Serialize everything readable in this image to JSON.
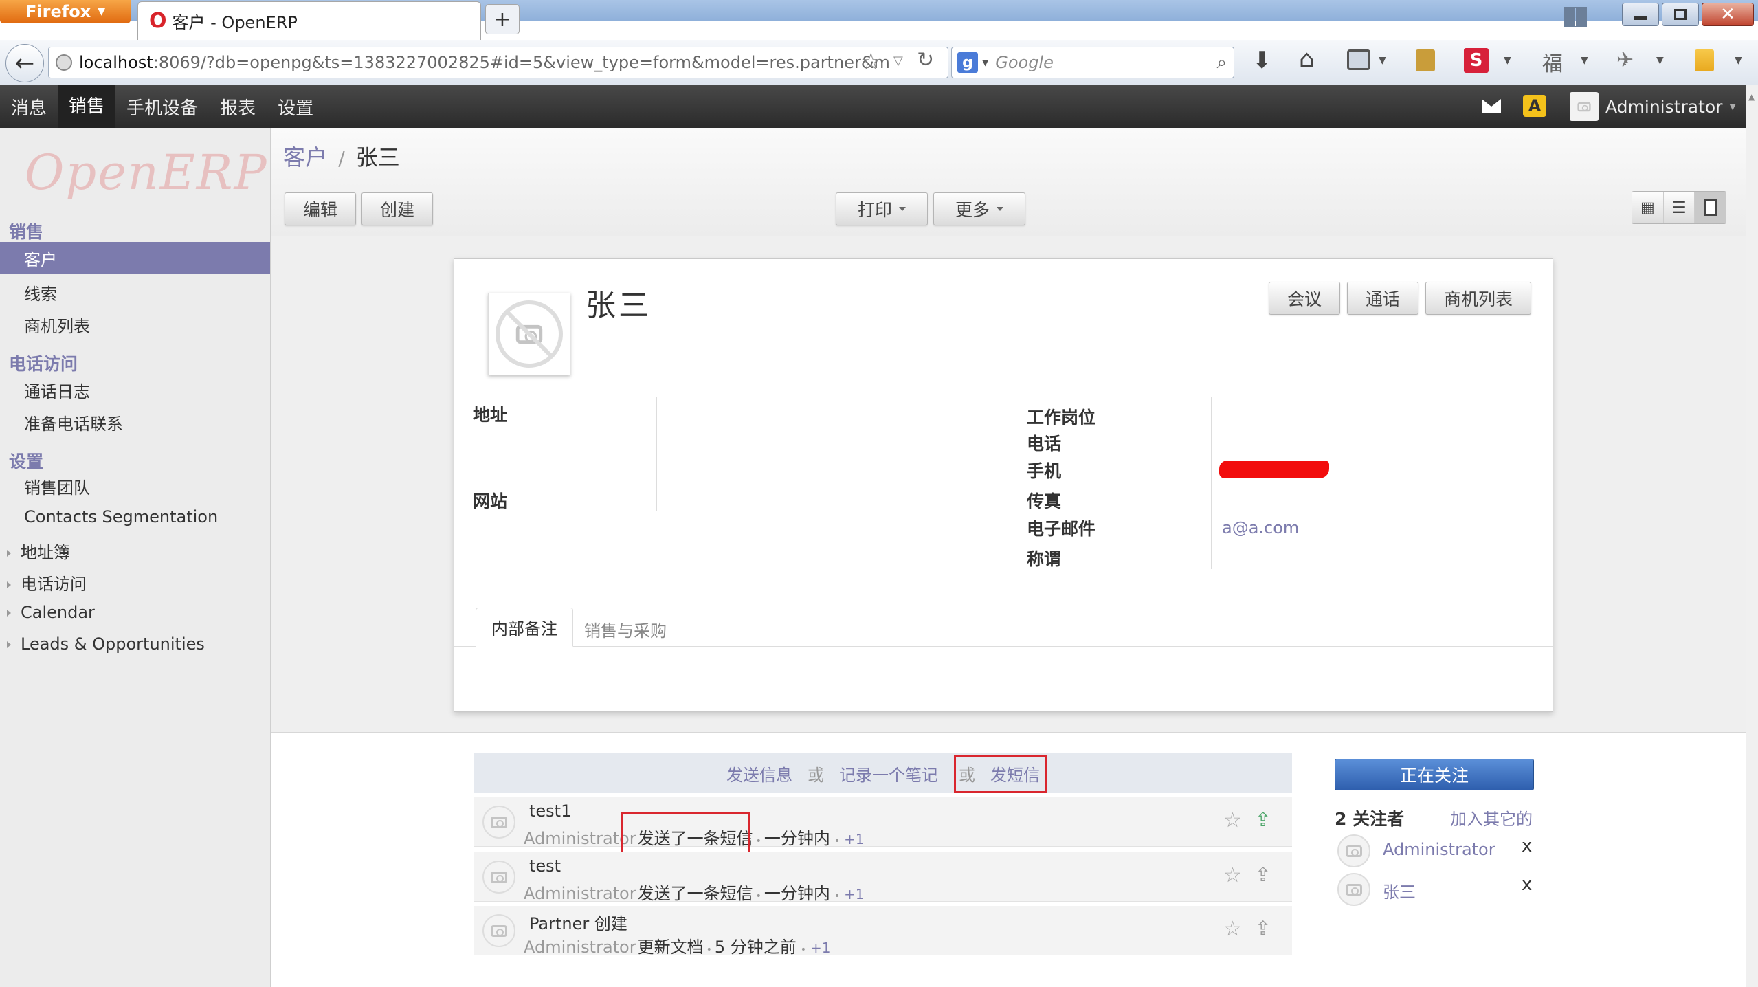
{
  "browser": {
    "app_button": "Firefox",
    "tab_title": "客户 - OpenERP",
    "new_tab": "+",
    "url_host": "localhost",
    "url_rest": ":8069/?db=openpg&ts=1383227002825#id=5&view_type=form&model=res.partner&m",
    "search_placeholder": "Google"
  },
  "topnav": {
    "items": [
      "消息",
      "销售",
      "手机设备",
      "报表",
      "设置"
    ],
    "user": "Administrator"
  },
  "sidebar": {
    "logo": "OpenERP",
    "sections": [
      {
        "title": "销售",
        "items": [
          "客户",
          "线索",
          "商机列表"
        ]
      },
      {
        "title": "电话访问",
        "items": [
          "通话日志",
          "准备电话联系"
        ]
      },
      {
        "title": "设置",
        "items": [
          "销售团队",
          "Contacts Segmentation"
        ]
      }
    ],
    "expandable": [
      "地址簿",
      "电话访问",
      "Calendar",
      "Leads & Opportunities"
    ]
  },
  "breadcrumb": {
    "parent": "客户",
    "sep": "/",
    "current": "张三"
  },
  "toolbar": {
    "edit": "编辑",
    "create": "创建",
    "print": "打印",
    "more": "更多"
  },
  "form": {
    "name": "张三",
    "buttons": [
      "会议",
      "通话",
      "商机列表"
    ],
    "left_labels": {
      "address": "地址",
      "website": "网站"
    },
    "right_labels": [
      "工作岗位",
      "电话",
      "手机",
      "传真",
      "电子邮件",
      "称谓"
    ],
    "email": "a@a.com",
    "tabs": [
      "内部备注",
      "销售与采购"
    ]
  },
  "chatter": {
    "actions": {
      "send": "发送信息",
      "or1": "或",
      "note": "记录一个笔记",
      "or2": "或",
      "sms": "发短信"
    },
    "messages": [
      {
        "title": "test1",
        "author": "Administrator",
        "action": "发送了一条短信",
        "sep1": "•",
        "time": "一分钟内",
        "sep2": "•",
        "extra": "+1"
      },
      {
        "title": "test",
        "author": "Administrator",
        "action": "发送了一条短信",
        "sep1": "•",
        "time": "一分钟内",
        "sep2": "•",
        "extra": "+1"
      },
      {
        "title": "Partner 创建",
        "author": "Administrator",
        "action": "更新文档",
        "sep1": "•",
        "time": "5 分钟之前",
        "sep2": "•",
        "extra": "+1"
      }
    ]
  },
  "followers": {
    "following_button": "正在关注",
    "count_label": "2 关注者",
    "add_others": "加入其它的",
    "list": [
      "Administrator",
      "张三"
    ],
    "remove": "x"
  },
  "colors": {
    "accent": "#7c7bad",
    "topbar": "#3a3a3a",
    "highlight_box": "#d9262e",
    "follow_button": "#3a6fbf"
  }
}
